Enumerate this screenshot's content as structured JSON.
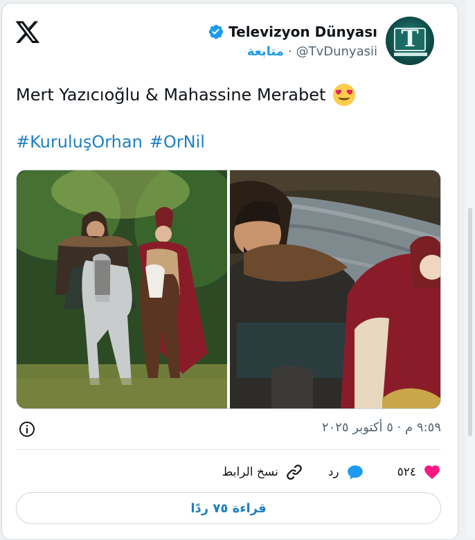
{
  "author": {
    "name": "Televizyon Dünyası",
    "handle": "@TvDunyasii",
    "separator": "·",
    "follow_label": "متابعة",
    "avatar_letter": "T"
  },
  "tweet": {
    "text": "Mert Yazıcıoğlu & Mahassine Merabet",
    "emoji_icon": "heart-eyes-emoji",
    "hashtags": [
      "#KuruluşOrhan",
      "#OrNil"
    ]
  },
  "timestamp": "٩:٥٩ م · ٥ أكتوبر ٢٠٢٥",
  "actions": {
    "like_count": "٥٢٤",
    "reply_label": "رد",
    "copy_label": "نسخ الرابط"
  },
  "read_more_label": "قراءة ٧٥ ردًا",
  "colors": {
    "accent": "#1d9bf0",
    "like": "#f91880",
    "text": "#0f1419",
    "muted": "#536471"
  }
}
